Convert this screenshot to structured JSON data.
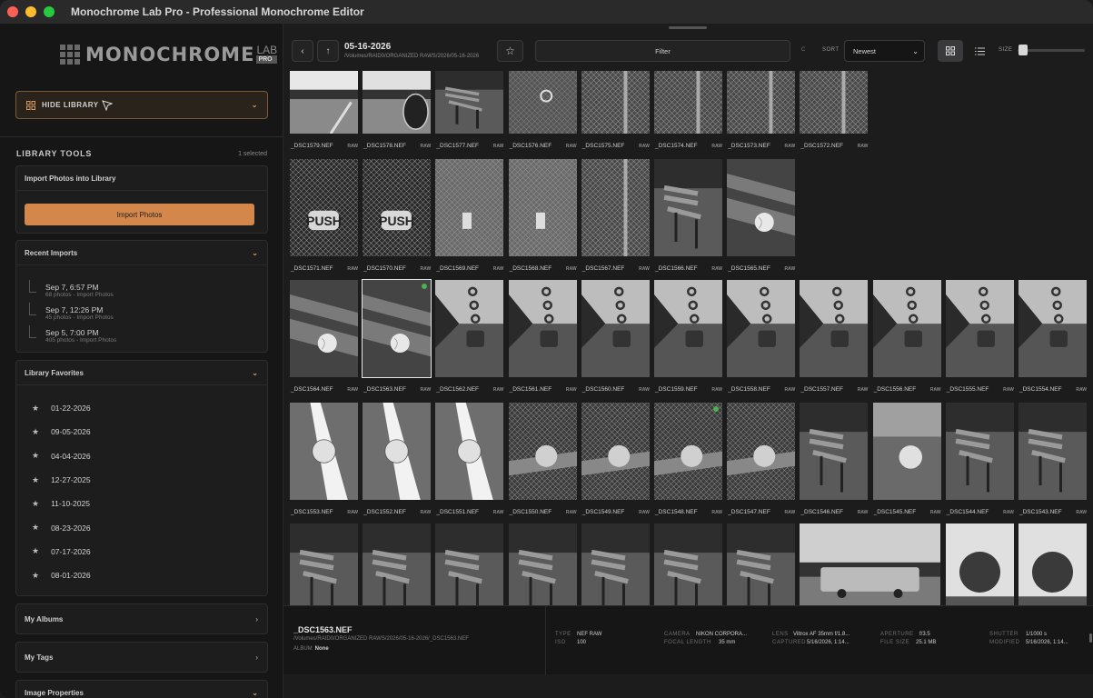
{
  "window": {
    "title": "Monochrome Lab Pro - Professional Monochrome Editor",
    "traffic_colors": [
      "#fe5f57",
      "#febc2e",
      "#28c840"
    ]
  },
  "sidebar": {
    "logo": {
      "text": "MONOCHROME",
      "lab": "LAB",
      "pro": "PRO"
    },
    "hide_library_label": "HIDE LIBRARY",
    "library_tools_title": "LIBRARY TOOLS",
    "selected_count": "1 selected",
    "import_panel": {
      "title": "Import Photos into Library",
      "button_label": "Import Photos"
    },
    "recent_imports": {
      "title": "Recent Imports",
      "items": [
        {
          "date": "Sep 7, 6:57 PM",
          "detail": "68 photos - Import Photos"
        },
        {
          "date": "Sep 7, 12:26 PM",
          "detail": "45 photos - Import Photos"
        },
        {
          "date": "Sep 5, 7:00 PM",
          "detail": "405 photos - Import Photos"
        }
      ]
    },
    "favorites": {
      "title": "Library Favorites",
      "items": [
        "01-22-2026",
        "09-05-2026",
        "04-04-2026",
        "12-27-2025",
        "11-10-2025",
        "08-23-2026",
        "07-17-2026",
        "08-01-2026"
      ]
    },
    "albums_label": "My Albums",
    "tags_label": "My Tags",
    "image_properties_label": "Image Properties"
  },
  "toolbar": {
    "folder_title": "05-16-2026",
    "folder_path": "/Volumes/RAID0/ORGANIZED RAWS/2026/05-16-2026",
    "filter_label": "Filter",
    "c_label": "C",
    "sort_label": "SORT",
    "sort_value": "Newest",
    "size_label": "SIZE",
    "size_value": 0.02
  },
  "grid": {
    "raw_badge": "RAW",
    "rows": [
      {
        "kind": "short",
        "files": [
          "_DSC1579.NEF",
          "_DSC1578.NEF",
          "_DSC1577.NEF",
          "_DSC1576.NEF",
          "_DSC1575.NEF",
          "_DSC1574.NEF",
          "_DSC1573.NEF",
          "_DSC1572.NEF"
        ],
        "thumbs": [
          "field",
          "car-mirror",
          "bench",
          "lock-fence",
          "fence",
          "fence",
          "fence",
          "fence"
        ]
      },
      {
        "kind": "tall",
        "files": [
          "_DSC1571.NEF",
          "_DSC1570.NEF",
          "_DSC1569.NEF",
          "_DSC1568.NEF",
          "_DSC1567.NEF",
          "_DSC1566.NEF",
          "_DSC1565.NEF"
        ],
        "thumbs": [
          "push-sign",
          "push-sign",
          "fence-wide",
          "fence-wide",
          "fence",
          "bench",
          "ball-bench"
        ],
        "push_text": "PUSH"
      },
      {
        "kind": "tall",
        "files": [
          "_DSC1564.NEF",
          "_DSC1563.NEF",
          "_DSC1562.NEF",
          "_DSC1561.NEF",
          "_DSC1560.NEF",
          "_DSC1559.NEF",
          "_DSC1558.NEF",
          "_DSC1557.NEF",
          "_DSC1556.NEF",
          "_DSC1555.NEF",
          "_DSC1554.NEF"
        ],
        "thumbs": [
          "ball-bench",
          "ball-bench",
          "padlock",
          "padlock",
          "padlock",
          "padlock",
          "padlock",
          "padlock",
          "padlock",
          "padlock",
          "padlock"
        ]
      },
      {
        "kind": "tall",
        "files": [
          "_DSC1553.NEF",
          "_DSC1552.NEF",
          "_DSC1551.NEF",
          "_DSC1550.NEF",
          "_DSC1549.NEF",
          "_DSC1548.NEF",
          "_DSC1547.NEF",
          "_DSC1546.NEF",
          "_DSC1545.NEF",
          "_DSC1544.NEF",
          "_DSC1543.NEF"
        ],
        "thumbs": [
          "ball-line",
          "ball-line",
          "ball-line",
          "ball-fence",
          "ball-fence",
          "ball-fence",
          "ball-fence",
          "park-bench",
          "ball-blur",
          "park-bench",
          "park-bench"
        ]
      },
      {
        "kind": "tall",
        "files": [
          "",
          "",
          "",
          "",
          "",
          "",
          "",
          "",
          "",
          "",
          ""
        ],
        "thumbs": [
          "park-bench",
          "park-bench",
          "park-bench",
          "park-bench",
          "park-bench",
          "park-bench",
          "park-bench",
          "truck",
          "truck",
          "tree",
          "tree"
        ]
      }
    ],
    "selected_file": "_DSC1563.NEF",
    "selected_dot_color": "#4caf50"
  },
  "info": {
    "filename": "_DSC1563.NEF",
    "path": "/Volumes/RAID0/ORGANIZED RAWS/2026/05-16-2026/_DSC1563.NEF",
    "album_label": "ALBUM",
    "album_value": "None",
    "type_label": "TYPE",
    "type_value": "NEF RAW",
    "iso_label": "ISO",
    "iso_value": "100",
    "camera_label": "CAMERA",
    "camera_value": "NIKON CORPORA...",
    "focal_label": "FOCAL LENGTH",
    "focal_value": "35 mm",
    "lens_label": "LENS",
    "lens_value": "Viltrox AF 35mm f/1.8...",
    "captured_label": "CAPTURED",
    "captured_value": "5/16/2026, 1:14...",
    "aperture_label": "APERTURE",
    "aperture_value": "f/3.5",
    "filesize_label": "FILE SIZE",
    "filesize_value": "25.1 MB",
    "shutter_label": "SHUTTER",
    "shutter_value": "1/1000 s",
    "modified_label": "MODIFIED",
    "modified_value": "5/16/2026, 1:14..."
  },
  "colors": {
    "accent": "#d3874a",
    "selected_border": "#e6e6e6"
  }
}
